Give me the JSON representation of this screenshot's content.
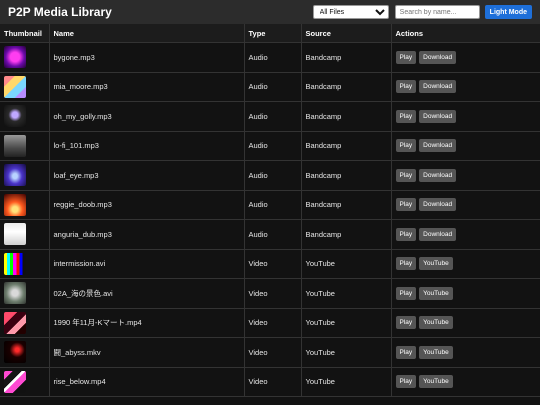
{
  "header": {
    "title": "P2P Media Library",
    "filter_selected": "All Files",
    "search_placeholder": "Search by name...",
    "mode_button": "Light Mode"
  },
  "table": {
    "columns": [
      "Thumbnail",
      "Name",
      "Type",
      "Source",
      "Actions"
    ],
    "rows": [
      {
        "name": "bygone.mp3",
        "type": "Audio",
        "source": "Bandcamp",
        "play": "Play",
        "second": "Download",
        "thumb": "thumb-magenta-abstract"
      },
      {
        "name": "mia_moore.mp3",
        "type": "Audio",
        "source": "Bandcamp",
        "play": "Play",
        "second": "Download",
        "thumb": "thumb-pastel-grid"
      },
      {
        "name": "oh_my_golly.mp3",
        "type": "Audio",
        "source": "Bandcamp",
        "play": "Play",
        "second": "Download",
        "thumb": "thumb-dark-statue"
      },
      {
        "name": "lo-fi_101.mp3",
        "type": "Audio",
        "source": "Bandcamp",
        "play": "Play",
        "second": "Download",
        "thumb": "thumb-grey-building"
      },
      {
        "name": "loaf_eye.mp3",
        "type": "Audio",
        "source": "Bandcamp",
        "play": "Play",
        "second": "Download",
        "thumb": "thumb-blue-eye"
      },
      {
        "name": "reggie_doob.mp3",
        "type": "Audio",
        "source": "Bandcamp",
        "play": "Play",
        "second": "Download",
        "thumb": "thumb-fire"
      },
      {
        "name": "anguria_dub.mp3",
        "type": "Audio",
        "source": "Bandcamp",
        "play": "Play",
        "second": "Download",
        "thumb": "thumb-white-cone"
      },
      {
        "name": "intermission.avi",
        "type": "Video",
        "source": "YouTube",
        "play": "Play",
        "second": "YouTube",
        "thumb": "thumb-color-bars"
      },
      {
        "name": "02A_海の景色.avi",
        "type": "Video",
        "source": "YouTube",
        "play": "Play",
        "second": "YouTube",
        "thumb": "thumb-grey-figure"
      },
      {
        "name": "1990 年11月-Kマート.mp4",
        "type": "Video",
        "source": "YouTube",
        "play": "Play",
        "second": "YouTube",
        "thumb": "thumb-red-collage"
      },
      {
        "name": "闘_abyss.mkv",
        "type": "Video",
        "source": "YouTube",
        "play": "Play",
        "second": "YouTube",
        "thumb": "thumb-dark-red"
      },
      {
        "name": "rise_below.mp4",
        "type": "Video",
        "source": "YouTube",
        "play": "Play",
        "second": "YouTube",
        "thumb": "thumb-pink-noise"
      }
    ]
  }
}
